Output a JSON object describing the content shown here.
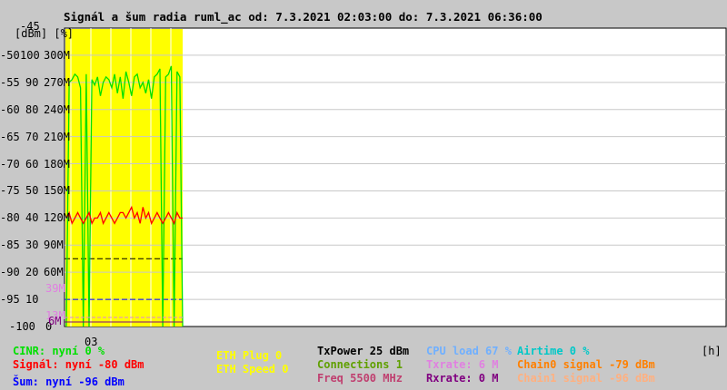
{
  "title": "Signál a šum radia ruml_ac od: 7.3.2021 02:03:00 do: 7.3.2021 06:36:00",
  "chart_data": {
    "type": "line",
    "title": "Signál a šum radia ruml_ac od: 7.3.2021 02:03:00 do: 7.3.2021 06:36:00",
    "axis_headers": {
      "top": "-45",
      "units": "[dBm] [%]"
    },
    "ylim": [
      -100,
      -45
    ],
    "y_ticks": [
      {
        "dbm": "-50",
        "pct": "100",
        "rate": "300M"
      },
      {
        "dbm": "-55",
        "pct": "90",
        "rate": "270M"
      },
      {
        "dbm": "-60",
        "pct": "80",
        "rate": "240M"
      },
      {
        "dbm": "-65",
        "pct": "70",
        "rate": "210M"
      },
      {
        "dbm": "-70",
        "pct": "60",
        "rate": "180M"
      },
      {
        "dbm": "-75",
        "pct": "50",
        "rate": "150M"
      },
      {
        "dbm": "-80",
        "pct": "40",
        "rate": "120M"
      },
      {
        "dbm": "-85",
        "pct": "30",
        "rate": "90M"
      },
      {
        "dbm": "-90",
        "pct": "20",
        "rate": "60M"
      },
      {
        "dbm": "-95",
        "pct": "10",
        "rate": ""
      },
      {
        "dbm": "-100",
        "pct": "0",
        "rate": ""
      }
    ],
    "extra_ticks": [
      {
        "label": "39M",
        "color": "#e080e0",
        "dbm": -93
      },
      {
        "label": "13M",
        "color": "#e080e0",
        "dbm": -98
      },
      {
        "label": "6M",
        "color": "#800080",
        "dbm": -99
      }
    ],
    "x_ticks": [
      "03"
    ],
    "x_unit": "[h]",
    "grid": true,
    "series": [
      {
        "name": "CINR",
        "color": "#00e000",
        "unit": "%",
        "values": [
          0,
          90,
          91,
          93,
          92,
          88,
          0,
          93,
          0,
          91,
          89,
          92,
          85,
          90,
          92,
          91,
          88,
          93,
          86,
          92,
          84,
          94,
          90,
          85,
          92,
          93,
          88,
          90,
          86,
          91,
          84,
          92,
          93,
          95,
          0,
          92,
          93,
          96,
          0,
          94,
          92,
          0
        ]
      },
      {
        "name": "Signál",
        "color": "#ff0000",
        "unit": "dBm",
        "values": [
          -80,
          -79,
          -81,
          -80,
          -79,
          -80,
          -81,
          -80,
          -79,
          -81,
          -80,
          -80,
          -79,
          -81,
          -80,
          -79,
          -80,
          -81,
          -80,
          -79,
          -79,
          -80,
          -79,
          -78,
          -80,
          -79,
          -81,
          -78,
          -80,
          -79,
          -81,
          -80,
          -79,
          -80,
          -81,
          -80,
          -79,
          -80,
          -81,
          -79,
          -80,
          -80
        ]
      },
      {
        "name": "Šum",
        "color": "#0000ff",
        "unit": "dBm",
        "values": [
          -96,
          -96,
          -96,
          -96,
          -96,
          -96,
          -96,
          -96,
          -96,
          -96,
          -96,
          -96,
          -96,
          -96,
          -96,
          -96,
          -96,
          -96,
          -96,
          -96,
          -96,
          -96,
          -96,
          -96,
          -96,
          -96,
          -96,
          -96,
          -96,
          -96,
          -96,
          -96,
          -96,
          -96,
          -96,
          -96,
          -96,
          -96,
          -96,
          -96,
          -96,
          -96
        ]
      },
      {
        "name": "TxPower",
        "color": "#000000",
        "unit": "dBm",
        "values": [
          -87.5
        ]
      }
    ]
  },
  "legend": [
    {
      "text": "CINR: nyní 0 %",
      "color": "#00e000"
    },
    {
      "text": "Signál: nyní -80 dBm",
      "color": "#ff0000"
    },
    {
      "text": "Šum: nyní -96 dBm",
      "color": "#0000ff"
    },
    {
      "text": "ETH Plug 0",
      "color": "#ffff00"
    },
    {
      "text": "ETH Speed 0",
      "color": "#ffff00"
    },
    {
      "text": "TxPower 25 dBm",
      "color": "#000000"
    },
    {
      "text": "Connections 1",
      "color": "#60a000"
    },
    {
      "text": "Freq 5500 MHz",
      "color": "#c04070"
    },
    {
      "text": "CPU load 67 %",
      "color": "#70b0ff"
    },
    {
      "text": "Txrate: 6 M",
      "color": "#e080e0"
    },
    {
      "text": "Rxrate: 0 M",
      "color": "#800080"
    },
    {
      "text": "Airtime 0 %",
      "color": "#00c8c8"
    },
    {
      "text": "Chain0 signal -79 dBm",
      "color": "#ff8000"
    },
    {
      "text": "Chain1 signal -96 dBm",
      "color": "#ffb080"
    }
  ]
}
